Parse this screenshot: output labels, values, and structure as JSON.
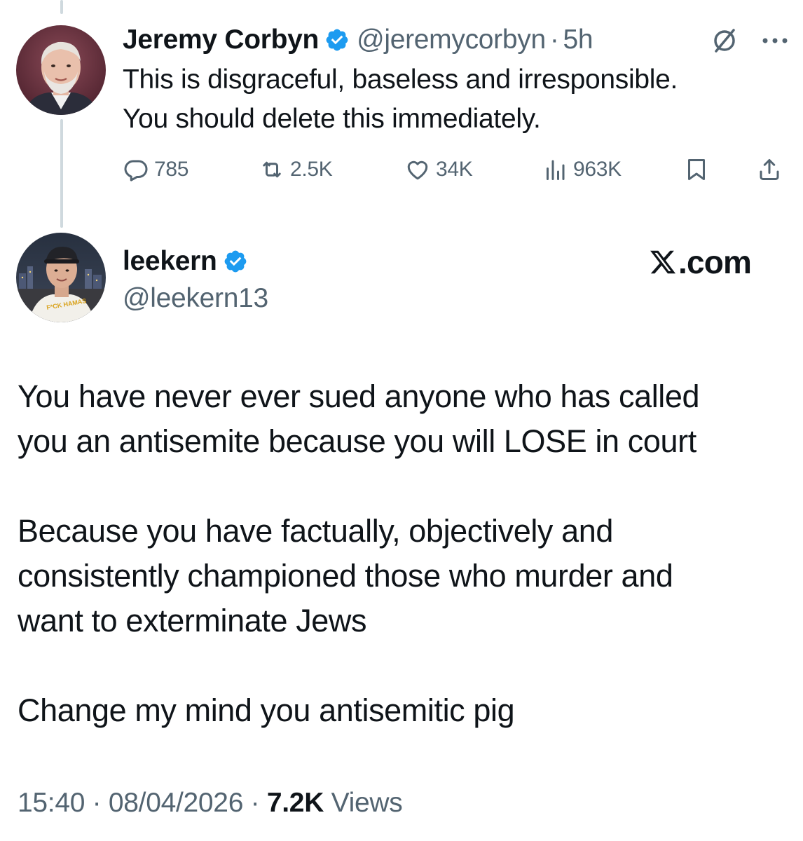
{
  "reply_tweet": {
    "display_name": "Jeremy Corbyn",
    "handle": "@jeremycorbyn",
    "separator": "·",
    "time": "5h",
    "text_lines": [
      "This is disgraceful, baseless and irresponsible.",
      "You should delete this immediately."
    ],
    "actions": {
      "replies": "785",
      "retweets": "2.5K",
      "likes": "34K",
      "views": "963K"
    }
  },
  "main_tweet": {
    "display_name": "leekern",
    "handle": "@leekern13",
    "brand": ".com",
    "paragraphs": [
      [
        "You have never ever sued anyone who has called",
        "you an antisemite because you will LOSE in court"
      ],
      [
        "Because you have factually, objectively and",
        "consistently championed those who murder and",
        "want to exterminate Jews"
      ],
      [
        "Change my mind you antisemitic pig"
      ]
    ],
    "avatar_shirt_text": "F*CK HAMAS",
    "meta": {
      "time": "15:40",
      "separator": "·",
      "date": "08/04/2026",
      "views_count": "7.2K",
      "views_label": "Views"
    }
  },
  "colors": {
    "verified": "#1d9bf0",
    "primary_text": "#0f1419",
    "secondary_text": "#536471",
    "thread_line": "#cfd9de"
  },
  "icons": [
    "grok-icon",
    "more-icon",
    "reply-icon",
    "retweet-icon",
    "like-icon",
    "views-icon",
    "bookmark-icon",
    "share-icon",
    "x-logo-icon",
    "verified-badge-icon"
  ]
}
